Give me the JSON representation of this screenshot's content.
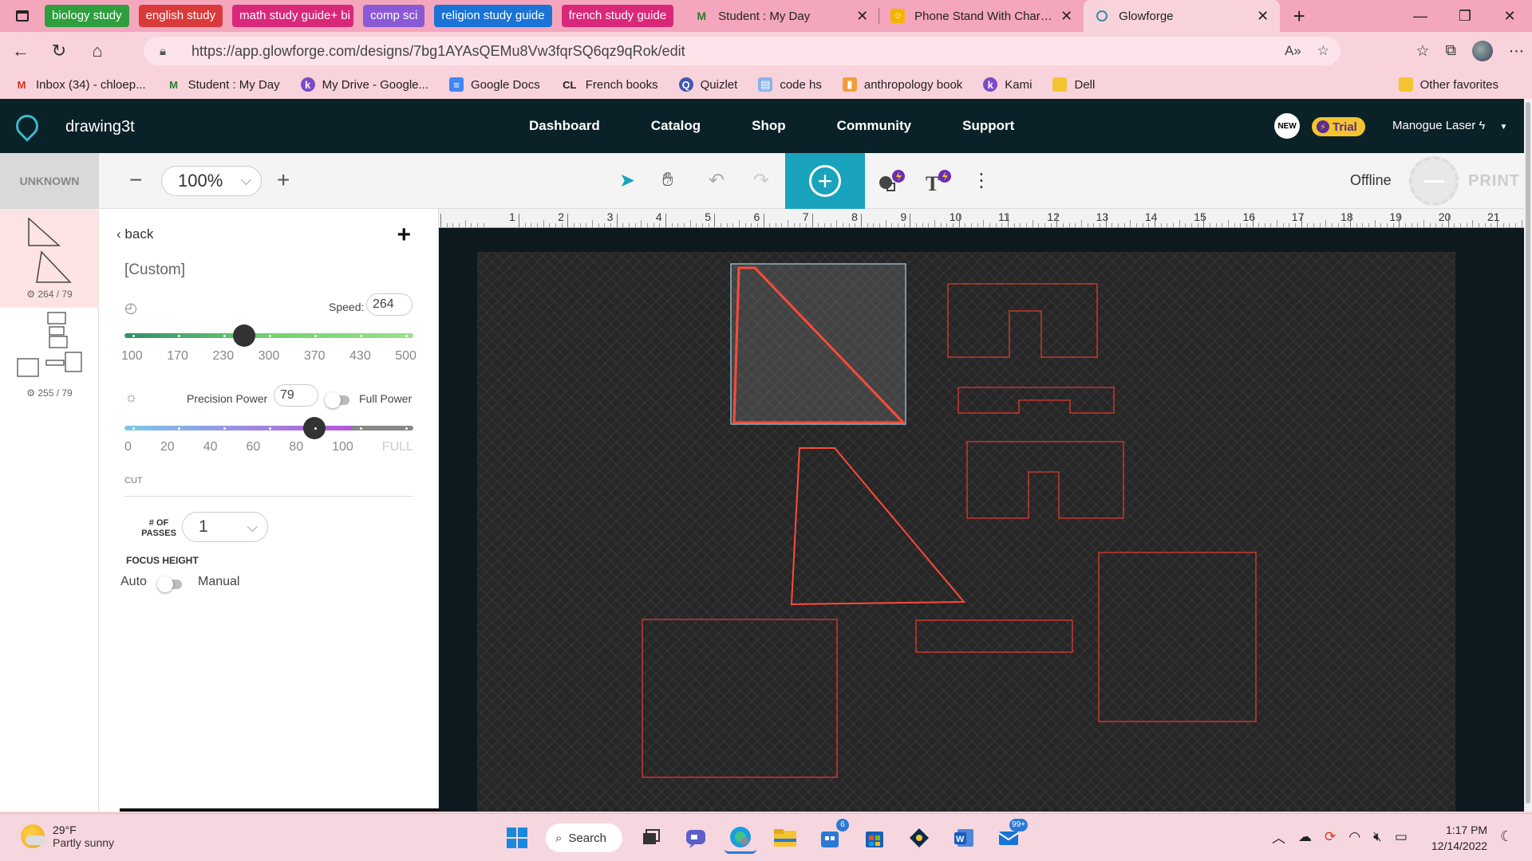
{
  "browser": {
    "tab_groups": [
      {
        "label": "biology study",
        "color": "#2e9e3e"
      },
      {
        "label": "english study",
        "color": "#d93a3a"
      },
      {
        "label": "math study guide+ bi",
        "color": "#d9287a"
      },
      {
        "label": "comp sci",
        "color": "#8a5ad6"
      },
      {
        "label": "religion study guide",
        "color": "#1a73d6"
      },
      {
        "label": "french study guide",
        "color": "#d9287a"
      }
    ],
    "tabs": [
      {
        "title": "Student : My Day",
        "close": "✕"
      },
      {
        "title": "Phone Stand With Charge",
        "close": "✕"
      },
      {
        "title": "Glowforge",
        "close": "✕"
      }
    ],
    "url": "https://app.glowforge.com/designs/7bg1AYAsQEMu8Vw3fqrSQ6qz9qRok/edit",
    "favorites": [
      {
        "label": "Inbox (34) - chloep...",
        "icon": "gmail-icon"
      },
      {
        "label": "Student : My Day",
        "icon": "mcgraw-icon"
      },
      {
        "label": "My Drive - Google...",
        "icon": "kami-icon"
      },
      {
        "label": "Google Docs",
        "icon": "docs-icon"
      },
      {
        "label": "French books",
        "icon": "cl-icon"
      },
      {
        "label": "Quizlet",
        "icon": "quizlet-icon"
      },
      {
        "label": "code hs",
        "icon": "codehs-icon"
      },
      {
        "label": "anthropology book",
        "icon": "book-icon"
      },
      {
        "label": "Kami",
        "icon": "kami-icon"
      },
      {
        "label": "Dell",
        "icon": "folder-icon"
      }
    ],
    "other_favorites": "Other favorites"
  },
  "app": {
    "design_title": "drawing3t",
    "nav": [
      "Dashboard",
      "Catalog",
      "Shop",
      "Community",
      "Support"
    ],
    "new_badge": "NEW",
    "trial": "Trial",
    "laser_name": "Manogue Laser",
    "accent": "#1aa3bd"
  },
  "toolbar": {
    "machine_status": "UNKNOWN",
    "zoom": "100%",
    "status": "Offline",
    "print": "PRINT"
  },
  "thumbnails": [
    {
      "meta": "264 / 79"
    },
    {
      "meta": "255 / 79"
    }
  ],
  "settings": {
    "back": "back",
    "preset": "[Custom]",
    "speed_label": "Speed:",
    "speed_value": "264",
    "speed_min": 100,
    "speed_max": 500,
    "speed_scale": [
      "100",
      "170",
      "230",
      "300",
      "370",
      "430",
      "500"
    ],
    "power_label": "Precision Power",
    "power_value": "79",
    "full_power_label": "Full Power",
    "power_scale": [
      "0",
      "20",
      "40",
      "60",
      "80",
      "100",
      "FULL"
    ],
    "operation": "CUT",
    "passes_label": "# OF PASSES",
    "passes_value": "1",
    "focus_label": "FOCUS HEIGHT",
    "focus_auto": "Auto",
    "focus_manual": "Manual"
  },
  "ruler": [
    "1",
    "1",
    "2",
    "3",
    "4",
    "5",
    "6",
    "7",
    "8",
    "9",
    "10",
    "11",
    "12",
    "13",
    "14",
    "15",
    "16",
    "17",
    "18",
    "19",
    "20",
    "21"
  ],
  "taskbar": {
    "temp": "29°F",
    "weather": "Partly sunny",
    "search": "Search",
    "badge_store": "6",
    "badge_mail": "99+",
    "time": "1:17 PM",
    "date": "12/14/2022"
  }
}
